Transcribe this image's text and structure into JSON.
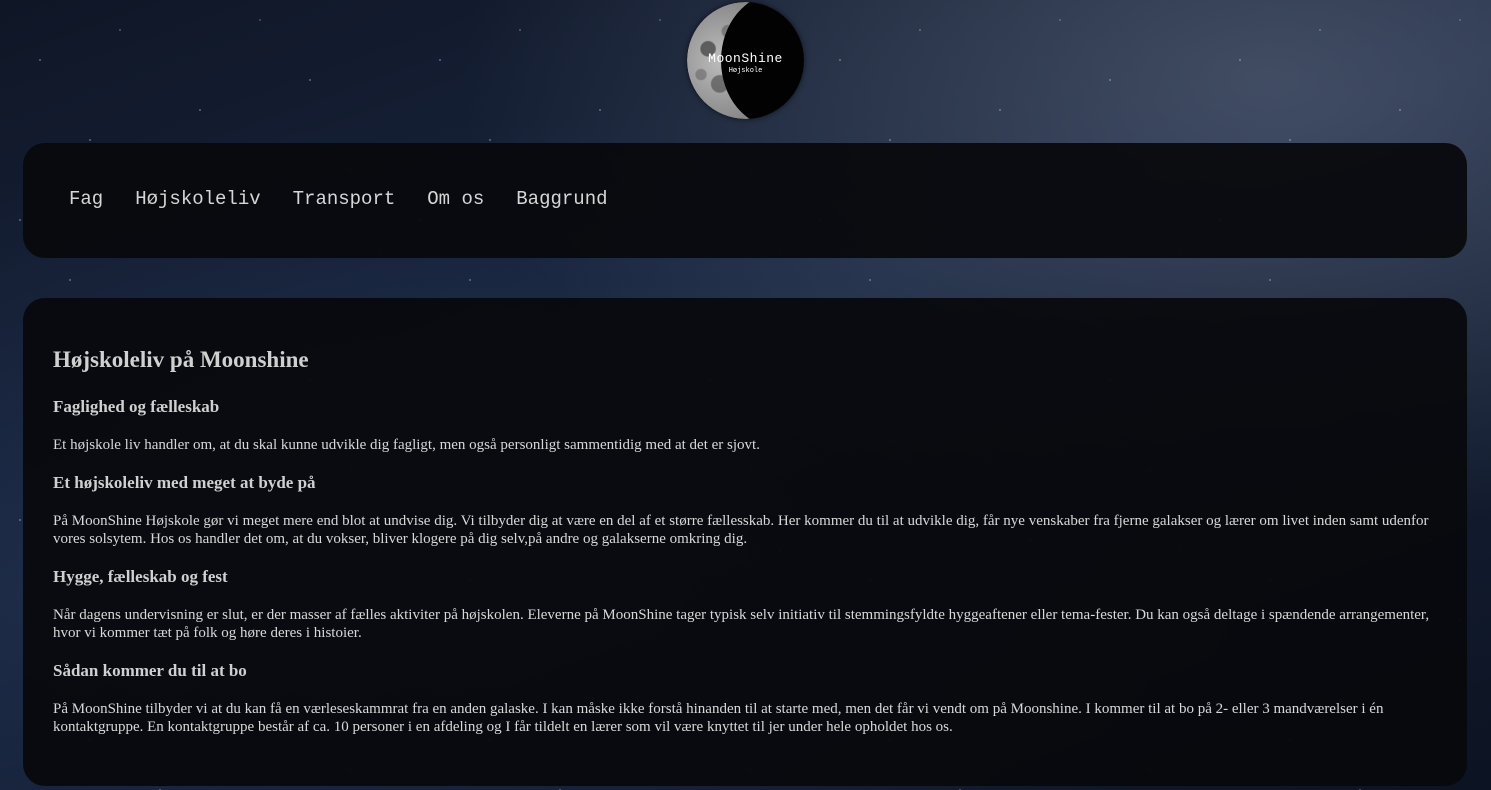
{
  "logo": {
    "title": "MoonShine",
    "subtitle": "Højskole"
  },
  "nav": {
    "items": [
      "Fag",
      "Højskoleliv",
      "Transport",
      "Om os",
      "Baggrund"
    ]
  },
  "main": {
    "title": "Højskoleliv på Moonshine",
    "sections": [
      {
        "heading": "Faglighed og fælleskab",
        "text": "Et højskole liv handler om, at du skal kunne udvikle dig fagligt, men også personligt sammentidig med at det er sjovt."
      },
      {
        "heading": "Et højskoleliv med meget at byde på",
        "text": "På MoonShine Højskole gør vi meget mere end blot at undvise dig. Vi tilbyder dig at være en del af et større fællesskab. Her kommer du til at udvikle dig, får nye venskaber fra fjerne galakser og lærer om livet inden samt udenfor vores solsytem. Hos os handler det om, at du vokser, bliver klogere på dig selv,på andre og galakserne omkring dig."
      },
      {
        "heading": "Hygge, fælleskab og fest",
        "text": "Når dagens undervisning er slut, er der masser af fælles aktiviter på højskolen. Eleverne på MoonShine tager typisk selv initiativ til stemmingsfyldte hyggeaftener eller tema-fester. Du kan også deltage i spændende arrangementer, hvor vi kommer tæt på folk og høre deres i histoier."
      },
      {
        "heading": "Sådan kommer du til at bo",
        "text": "På MoonShine tilbyder vi at du kan få en værleseskammrat fra en anden galaske. I kan måske ikke forstå hinanden til at starte med, men det får vi vendt om på Moonshine. I kommer til at bo på 2- eller 3 mandværelser i én kontaktgruppe. En kontaktgruppe består af ca. 10 personer i en afdeling og I får tildelt en lærer som vil være knyttet til jer under hele opholdet hos os."
      }
    ]
  }
}
